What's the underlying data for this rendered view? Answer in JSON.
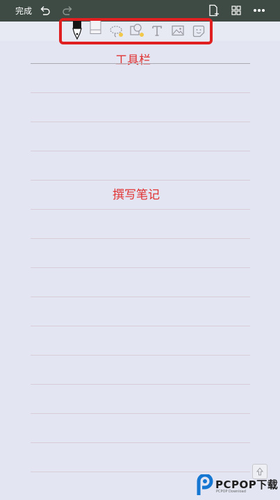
{
  "topbar": {
    "done_label": "完成",
    "icons": [
      "undo-icon",
      "redo-icon",
      "new-page-icon",
      "grid-icon",
      "more-icon"
    ]
  },
  "toolbar": {
    "tools": [
      "pen-icon",
      "eraser-icon",
      "lasso-icon",
      "shapes-icon",
      "text-icon",
      "image-icon",
      "sticker-icon"
    ]
  },
  "annotations": {
    "toolbar_label": "工具栏",
    "notes_label": "撰写笔记"
  },
  "watermark": {
    "brand": "PCPOP下载",
    "sub": "PCPOP Download"
  },
  "colors": {
    "topbar": "#3E4B45",
    "page": "#E3E6F2",
    "highlight": "#E02020",
    "annotation": "#E03030"
  }
}
